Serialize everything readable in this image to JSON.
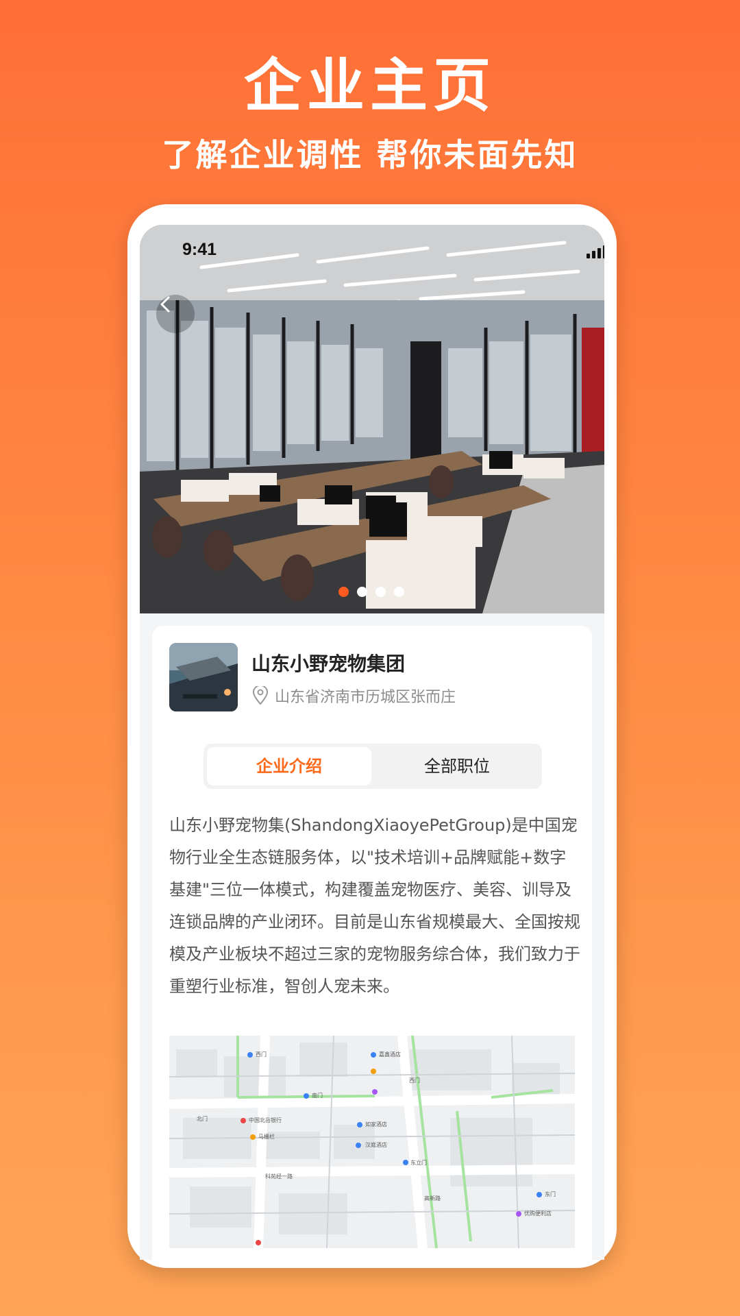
{
  "poster": {
    "title": "企业主页",
    "subtitle": "了解企业调性 帮你未面先知"
  },
  "status_bar": {
    "time": "9:41"
  },
  "icons": {
    "back": "chevron-left-icon",
    "location": "location-pin-icon",
    "signal": "signal-icon",
    "wifi": "wifi-icon",
    "battery": "battery-icon"
  },
  "carousel": {
    "total": 4,
    "active_index": 0
  },
  "company": {
    "name": "山东小野宠物集团",
    "address": "山东省济南市历城区张而庄"
  },
  "tabs": [
    {
      "label": "企业介绍",
      "active": true
    },
    {
      "label": "全部职位",
      "active": false
    }
  ],
  "intro_text": "山东小野宠物集(ShandongXiaoyePetGroup)是中国宠物行业全生态链服务体，以\"技术培训+品牌赋能+数字基建\"三位一体模式，构建覆盖宠物医疗、美容、训导及连锁品牌的产业闭环。目前是山东省规模最大、全国按规模及产业板块不超过三家的宠物服务综合体，我们致力于重塑行业标准，智创人宠未来。",
  "map": {
    "labels": [
      "西门",
      "嘉鑫酒店",
      "西门",
      "东门",
      "南门",
      "中国北岳银行",
      "马栅栏",
      "汉庭酒店",
      "如家酒店",
      "东立门",
      "科苑经一路",
      "高新路",
      "优购便利店",
      "北门"
    ]
  },
  "colors": {
    "accent": "#ff6a1a",
    "background_top": "#ff6f36",
    "background_bottom": "#ffa556"
  }
}
